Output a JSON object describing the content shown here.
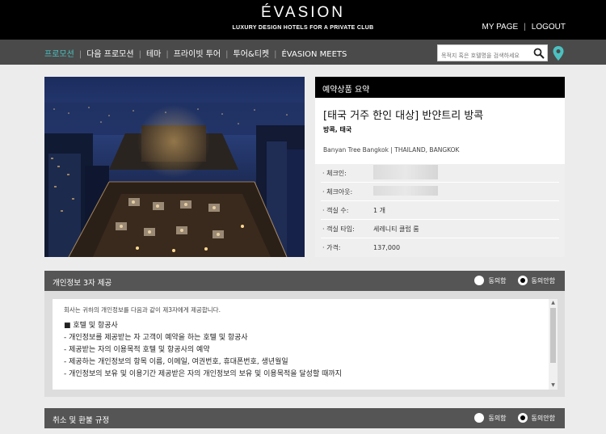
{
  "header": {
    "logo": "ÉVASION",
    "tagline": "LUXURY DESIGN HOTELS FOR A PRIVATE CLUB",
    "my_page": "MY PAGE",
    "separator": "|",
    "logout": "LOGOUT"
  },
  "nav": {
    "items": [
      {
        "label": "프로모션",
        "active": true
      },
      {
        "label": "다음 프로모션"
      },
      {
        "label": "테마"
      },
      {
        "label": "프라이빗 투어"
      },
      {
        "label": "투어&티켓"
      },
      {
        "label": "ÉVASION MEETS"
      }
    ],
    "separator": "|",
    "search_placeholder": "목적지 혹은 호텔명을 검색하세요"
  },
  "summary": {
    "header": "예약상품 요약",
    "title": "[태국 거주 한인 대상] 반얀트리 방콕",
    "location": "방콕, 태국",
    "subtitle": "Banyan Tree Bangkok  |  THAILAND, BANGKOK",
    "rows": [
      {
        "label": "· 체크인:",
        "value": ""
      },
      {
        "label": "· 체크아웃:",
        "value": ""
      },
      {
        "label": "· 객실 수:",
        "value": "1 개"
      },
      {
        "label": "· 객실 타입:",
        "value": "세레니티 클럽 룸"
      },
      {
        "label": "· 가격:",
        "value": "137,000"
      }
    ]
  },
  "privacy": {
    "title": "개인정보 3자 제공",
    "agree": "동의함",
    "disagree": "동의안함",
    "selected": "disagree",
    "intro": "회사는 귀하의 개인정보를 다음과 같이 제3자에게 제공합니다.",
    "lines": [
      "■ 호텔 및 항공사",
      "- 개인정보를 제공받는 자 고객이 예약을 하는 호텔 및 항공사",
      "- 제공받는 자의 이용목적 호텔 및 항공사의 예약",
      "- 제공하는 개인정보의 항목 이름, 이메일, 여권번호, 휴대폰번호, 생년월일",
      "- 개인정보의 보유 및 이용기간 제공받은 자의 개인정보의 보유 및 이용목적을 달성할 때까지"
    ]
  },
  "refund": {
    "title": "취소 및 환불 규정",
    "agree": "동의함",
    "disagree": "동의안함",
    "selected": "disagree"
  },
  "colors": {
    "accent": "#4cc0c0",
    "header_bg": "#000000",
    "nav_bg": "#4a4a4a",
    "section_bg": "#555555"
  }
}
